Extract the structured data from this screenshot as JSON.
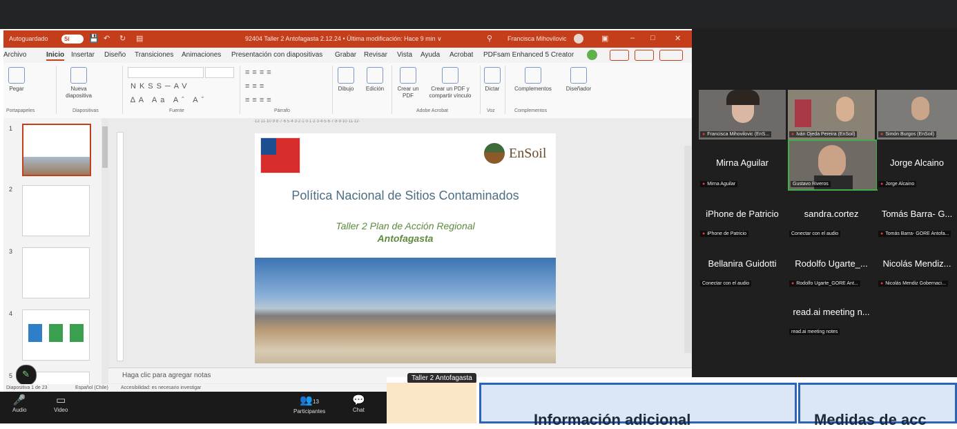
{
  "ppt": {
    "autosave_label": "Autoguardado",
    "autosave_state": "Sí",
    "doc_title": "92404 Taller 2 Antofagasta 2.12.24 • Última modificación: Hace 9 min ∨",
    "user_name": "Francisca Mihovilovic",
    "menu": [
      "Archivo",
      "Inicio",
      "Insertar",
      "Diseño",
      "Transiciones",
      "Animaciones",
      "Presentación con diapositivas",
      "Grabar",
      "Revisar",
      "Vista",
      "Ayuda",
      "Acrobat",
      "PDFsam Enhanced 5 Creator"
    ],
    "active_menu": "Inicio",
    "ribbon": {
      "pegar": "Pegar",
      "nueva_diapositiva": "Nueva diapositiva",
      "dibujo": "Dibujo",
      "edicion": "Edición",
      "crear_pdf": "Crear un PDF",
      "crear_pdf_compartir": "Crear un PDF y compartir vínculo",
      "dictar": "Dictar",
      "complementos": "Complementos",
      "disenador": "Diseñador",
      "group_portapapeles": "Portapapeles",
      "group_diapositivas": "Diapositivas",
      "group_fuente": "Fuente",
      "group_parrafo": "Párrafo",
      "group_adobe": "Adobe Acrobat",
      "group_voz": "Voz",
      "group_complementos": "Complementos"
    },
    "thumb_numbers": [
      "1",
      "2",
      "3",
      "4",
      "5"
    ],
    "slide": {
      "brand": "EnSoil",
      "title": "Política Nacional de Sitios Contaminados",
      "subtitle": "Taller 2 Plan de Acción Regional",
      "subtitle2": "Antofagasta"
    },
    "notes_placeholder": "Haga clic para agregar notas",
    "status_slide": "Diapositiva 1 de 23",
    "status_lang": "Español (Chile)",
    "status_access": "Accesibilidad: es necesario investigar"
  },
  "zoom": {
    "audio": "Audio",
    "video": "Video",
    "participants": "Participantes",
    "participants_count": "13",
    "chat": "Chat",
    "shared_title": "Taller 2 Antofagasta",
    "shared_col1": "Información adicional",
    "shared_col2": "Medidas de acc"
  },
  "participants": [
    {
      "name_big": "",
      "label": "Francisca Mihovilovic (EnS...",
      "muted": true
    },
    {
      "name_big": "",
      "label": "Iván Ojeda Pereira (EnSoil)",
      "muted": true
    },
    {
      "name_big": "",
      "label": "Simón Burgos (EnSoil)",
      "muted": true
    },
    {
      "name_big": "Mirna Aguilar",
      "label": "Mirna Aguilar",
      "muted": true
    },
    {
      "name_big": "",
      "label": "Gustavo Riveros",
      "muted": false
    },
    {
      "name_big": "Jorge Alcaino",
      "label": "Jorge Alcaino",
      "muted": true
    },
    {
      "name_big": "iPhone de Patricio",
      "label": "iPhone de Patricio",
      "muted": true
    },
    {
      "name_big": "sandra.cortez",
      "label": "Conectar con el audio",
      "muted": false
    },
    {
      "name_big": "Tomás Barra- G...",
      "label": "Tomás Barra- GORE Antofa...",
      "muted": true
    },
    {
      "name_big": "Bellanira Guidotti",
      "label": "Conectar con el audio",
      "muted": false
    },
    {
      "name_big": "Rodolfo Ugarte_...",
      "label": "Rodolfo Ugarte_GORE Ant...",
      "muted": true
    },
    {
      "name_big": "Nicolás Mendiz...",
      "label": "Nicolás Mendiz Gobernaci...",
      "muted": true
    },
    {
      "name_big": "read.ai meeting n...",
      "label": "read.ai meeting notes",
      "muted": false
    }
  ],
  "colors": {
    "ppt_accent": "#c43e1c",
    "active_speaker": "#3fae49",
    "muted": "#e03a3a"
  }
}
